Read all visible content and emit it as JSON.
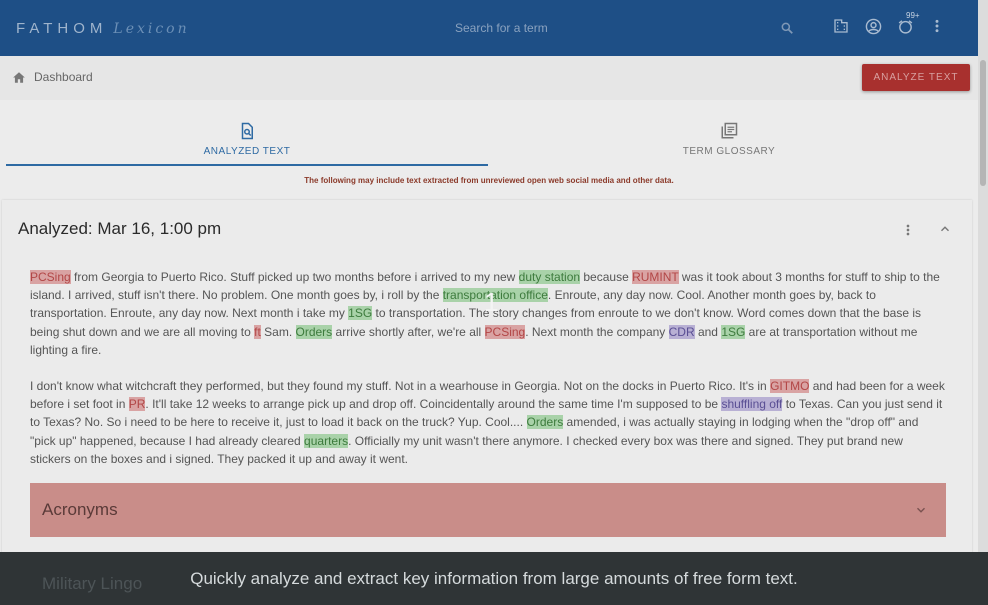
{
  "app": {
    "logo_main": "FATHOM",
    "logo_sub": "Lexicon"
  },
  "search": {
    "placeholder": "Search for a term"
  },
  "header": {
    "notif_badge": "99+"
  },
  "breadcrumb": {
    "label": "Dashboard"
  },
  "toolbar": {
    "analyze_label": "ANALYZE TEXT"
  },
  "tabs": [
    {
      "label": "ANALYZED TEXT",
      "icon": "document-search-icon"
    },
    {
      "label": "TERM GLOSSARY",
      "icon": "library-books-icon"
    }
  ],
  "disclaimer": "The following may include text extracted from unreviewed open web social media and other data.",
  "panel": {
    "title": "Analyzed: Mar 16, 1:00 pm",
    "para1": [
      {
        "t": "PCSing",
        "h": "red"
      },
      {
        "t": " from Georgia to Puerto Rico. Stuff picked up two months before i arrived to my new "
      },
      {
        "t": "duty station",
        "h": "green"
      },
      {
        "t": " because "
      },
      {
        "t": "RUMINT",
        "h": "red"
      },
      {
        "t": " was it took about 3 months for stuff to ship to the island. I arrived, stuff isn't there. No problem. One month goes by, i roll by the "
      },
      {
        "t": "transportation office",
        "h": "green"
      },
      {
        "t": ". Enroute, any day now. Cool. Another month goes by, back to transportation. Enroute, any day now. Next month i take my "
      },
      {
        "t": "1SG",
        "h": "green"
      },
      {
        "t": " to transportation. The story changes from enroute to we don't know. Word comes down that the base is being shut down and we are all moving to "
      },
      {
        "t": "ft",
        "h": "red"
      },
      {
        "t": " Sam. "
      },
      {
        "t": "Orders",
        "h": "green"
      },
      {
        "t": " arrive shortly after, we're all "
      },
      {
        "t": "PCSing",
        "h": "red"
      },
      {
        "t": ". Next month the company "
      },
      {
        "t": "CDR",
        "h": "purple"
      },
      {
        "t": " and "
      },
      {
        "t": "1SG",
        "h": "green"
      },
      {
        "t": " are at transportation without me lighting a fire."
      }
    ],
    "para2": [
      {
        "t": "I don't know what witchcraft they performed, but they found my stuff. Not in a wearhouse in Georgia. Not on the docks in Puerto Rico. It's in "
      },
      {
        "t": "GITMO",
        "h": "red"
      },
      {
        "t": " and had been for a week before i set foot in "
      },
      {
        "t": "PR",
        "h": "red"
      },
      {
        "t": ". It'll take 12 weeks to arrange pick up and drop off. Coincidentally around the same time I'm supposed to be "
      },
      {
        "t": "shuffling off",
        "h": "purple"
      },
      {
        "t": " to Texas. Can you just send it to Texas? No. So i need to be here to receive it, just to load it back on the truck? Yup. Cool.... "
      },
      {
        "t": "Orders",
        "h": "green"
      },
      {
        "t": " amended, i was actually staying in lodging when the \"drop off\" and \"pick up\" happened, because I had already cleared "
      },
      {
        "t": "quarters",
        "h": "green"
      },
      {
        "t": ". Officially my unit wasn't there anymore. I checked every box was there and signed. They put brand new stickers on the boxes and i signed. They packed it up and away it went."
      }
    ],
    "accordions": [
      "Acronyms",
      "Military Lingo"
    ]
  },
  "banner": {
    "text": "Quickly analyze and extract key information from large amounts of free form text.",
    "step": "1"
  }
}
